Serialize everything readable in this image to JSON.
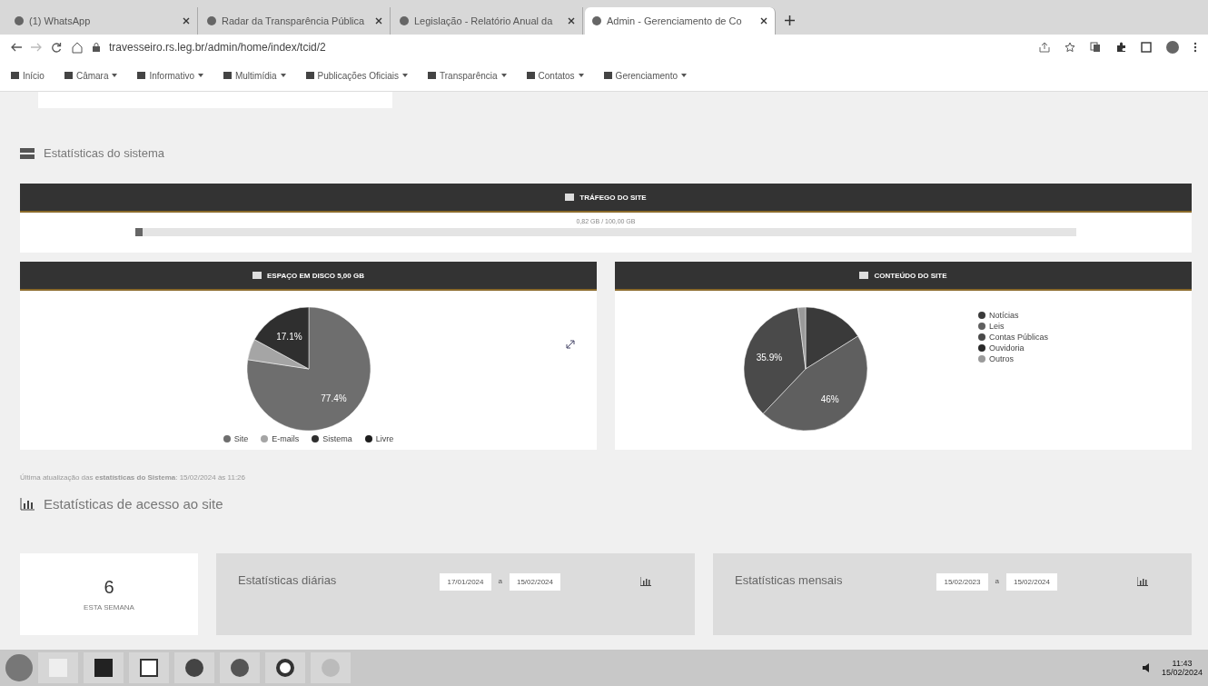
{
  "browser": {
    "tabs": [
      {
        "title": "(1) WhatsApp",
        "selected": false
      },
      {
        "title": "Radar da Transparência Pública",
        "selected": false
      },
      {
        "title": "Legislação - Relatório Anual da",
        "selected": false
      },
      {
        "title": "Admin - Gerenciamento de Co",
        "selected": true
      }
    ],
    "url": "travesseiro.rs.leg.br/admin/home/index/tcid/2"
  },
  "nav": [
    {
      "label": "Início",
      "dropdown": false
    },
    {
      "label": "Câmara",
      "dropdown": true
    },
    {
      "label": "Informativo",
      "dropdown": true
    },
    {
      "label": "Multimídia",
      "dropdown": true
    },
    {
      "label": "Publicações Oficiais",
      "dropdown": true
    },
    {
      "label": "Transparência",
      "dropdown": true
    },
    {
      "label": "Contatos",
      "dropdown": true
    },
    {
      "label": "Gerenciamento",
      "dropdown": true
    }
  ],
  "system_stats": {
    "title": "Estatísticas do sistema",
    "traffic": {
      "title": "TRÁFEGO DO SITE",
      "reading": "0,82 GB / 100,00 GB",
      "level": 0.008
    },
    "disk": {
      "title": "ESPAÇO EM DISCO 5,00 GB",
      "chart_data": {
        "type": "pie",
        "categories": [
          "Site",
          "E-mails",
          "Sistema",
          "Livre"
        ],
        "series": [
          {
            "values": [
              77.4,
              5.5,
              17.1,
              0
            ]
          }
        ],
        "colors": [
          "#6e6e6e",
          "#a5a5a5",
          "#2f2f2f",
          "#1e1e1e"
        ],
        "value_labels": [
          "77.4%",
          null,
          "17.1%",
          null
        ]
      }
    },
    "content": {
      "title": "CONTEÚDO DO SITE",
      "chart_data": {
        "type": "pie",
        "categories": [
          "Notícias",
          "Leis",
          "Contas Públicas",
          "Ouvidoria",
          "Outros"
        ],
        "series": [
          {
            "values": [
              16.1,
              46,
              35.9,
              0,
              2
            ]
          }
        ],
        "colors": [
          "#3a3a3a",
          "#5f5f5f",
          "#4a4a4a",
          "#2a2a2a",
          "#9a9a9a"
        ],
        "value_labels": [
          null,
          "46%",
          "35.9%",
          null,
          null
        ]
      }
    },
    "updated": "Última atualização das **estatísticas do Sistema**: 15/02/2024 às 11:26"
  },
  "access_stats": {
    "title": "Estatísticas de acesso ao site",
    "week": {
      "value": "6",
      "label": "ESTA SEMANA"
    },
    "daily": {
      "title": "Estatísticas diárias",
      "from": "17/01/2024",
      "separator": "a",
      "to": "15/02/2024"
    },
    "monthly": {
      "title": "Estatísticas mensais",
      "from": "15/02/2023",
      "separator": "a",
      "to": "15/02/2024"
    }
  },
  "taskbar": {
    "time": "11:43",
    "date": "15/02/2024"
  }
}
